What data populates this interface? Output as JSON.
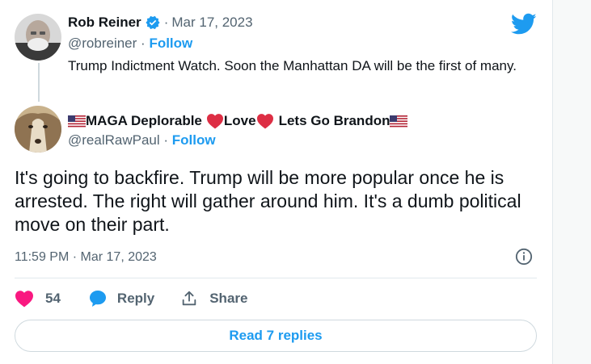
{
  "parent_tweet": {
    "name": "Rob Reiner",
    "date_separator": "·",
    "date": "Mar 17, 2023",
    "handle": "@robreiner",
    "handle_separator": "·",
    "follow_label": "Follow",
    "text": "Trump Indictment Watch. Soon the Manhattan DA will be the first of many.",
    "verified": true
  },
  "reply_tweet": {
    "name_part1": "MAGA Deplorable",
    "name_part2": "Love",
    "name_part3": "Lets Go Brandon",
    "handle": "@realRawPaul",
    "handle_separator": "·",
    "follow_label": "Follow",
    "text": "It's going to backfire. Trump will be more popular once he is arrested. The right will gather around him. It's a dumb political move on their part.",
    "timestamp": "11:59 PM · Mar 17, 2023"
  },
  "actions": {
    "like_count": "54",
    "reply_label": "Reply",
    "share_label": "Share"
  },
  "read_replies_label": "Read 7 replies",
  "icons": {
    "brand": "twitter-bird-icon",
    "verified": "verified-badge-icon",
    "like": "heart-icon",
    "reply": "speech-bubble-icon",
    "share": "share-upload-icon",
    "info": "info-icon"
  },
  "colors": {
    "accent": "#1d9bf0",
    "like": "#f91880",
    "text": "#0f1419",
    "muted": "#536471"
  }
}
